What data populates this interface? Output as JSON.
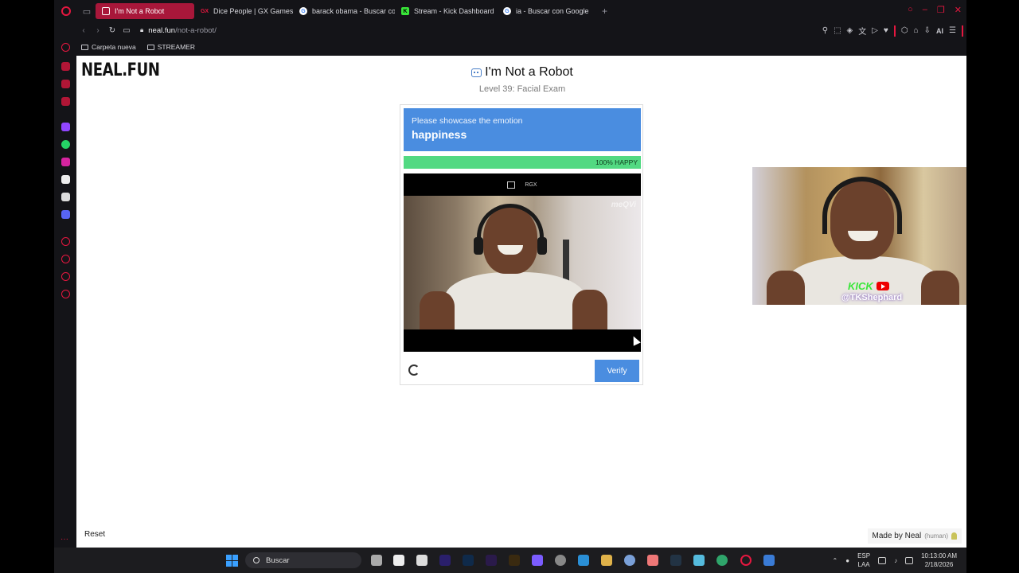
{
  "browser": {
    "tabs": [
      {
        "label": "I'm Not a Robot",
        "active": true,
        "favicon": "robot-icon",
        "color": "#e5173f"
      },
      {
        "label": "Dice People | GX Games",
        "active": false,
        "favicon": "gx-icon",
        "color": "#e5173f"
      },
      {
        "label": "barack obama - Buscar co",
        "active": false,
        "favicon": "google-icon",
        "color": "#ffffff"
      },
      {
        "label": "Stream - Kick Dashboard",
        "active": false,
        "favicon": "kick-icon",
        "color": "#39e639"
      },
      {
        "label": "ia - Buscar con Google",
        "active": false,
        "favicon": "google-icon",
        "color": "#ffffff"
      }
    ],
    "url_host": "neal.fun",
    "url_path": "/not-a-robot/",
    "toolbar_ai": "AI",
    "bookmarks": [
      {
        "label": "Carpeta nueva"
      },
      {
        "label": "STREAMER"
      }
    ],
    "accent_color": "#e5173f"
  },
  "page": {
    "brand": "NEAL.FUN",
    "title": "I'm Not a Robot",
    "level": "Level 39: Facial Exam",
    "captcha": {
      "prompt_line1": "Please showcase the emotion",
      "prompt_emotion": "happiness",
      "meter_percent": 100,
      "meter_label": "100% HAPPY",
      "video_tag": "RGX",
      "video_watermark": "meQVi",
      "verify_label": "Verify"
    },
    "webcam_overlay": {
      "handle": "@TKShephard",
      "kick_label": "KICK"
    },
    "reset_label": "Reset",
    "made_by": "Made by Neal",
    "made_by_note": "(human)"
  },
  "taskbar": {
    "search_placeholder": "Buscar",
    "lang_line1": "ESP",
    "lang_line2": "LAA",
    "time": "10:13:00 AM",
    "date": "2/18/2026"
  }
}
